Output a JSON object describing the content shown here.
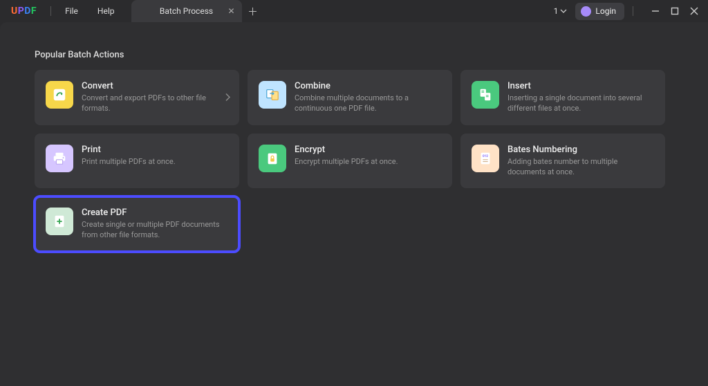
{
  "menu": {
    "file": "File",
    "help": "Help"
  },
  "tab": {
    "title": "Batch Process"
  },
  "header": {
    "count": "1",
    "login": "Login"
  },
  "section": {
    "title": "Popular Batch Actions"
  },
  "cards": {
    "convert": {
      "title": "Convert",
      "desc": "Convert and export PDFs to other file formats."
    },
    "combine": {
      "title": "Combine",
      "desc": "Combine multiple documents to a continuous one PDF file."
    },
    "insert": {
      "title": "Insert",
      "desc": "Inserting a single document into several different files at once."
    },
    "print": {
      "title": "Print",
      "desc": "Print multiple PDFs at once."
    },
    "encrypt": {
      "title": "Encrypt",
      "desc": "Encrypt multiple PDFs at once."
    },
    "bates": {
      "title": "Bates Numbering",
      "desc": "Adding bates number to multiple documents at once."
    },
    "create": {
      "title": "Create PDF",
      "desc": "Create single or multiple PDF documents from other file formats."
    }
  },
  "colors": {
    "convert": "#f7d74a",
    "combine": "#bfe4ff",
    "insert": "#4ac97e",
    "print": "#d6c6ff",
    "encrypt": "#4ac97e",
    "bates": "#ffe2c6",
    "create": "#cfe9d6"
  }
}
